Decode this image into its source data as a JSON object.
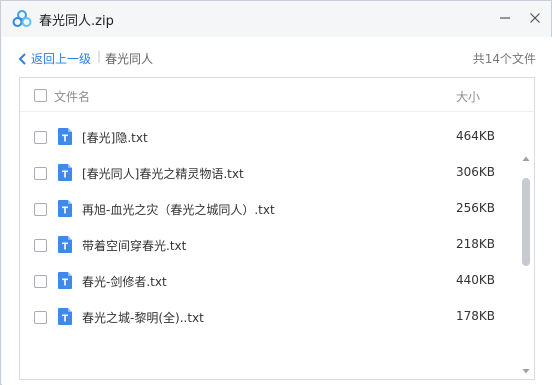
{
  "window": {
    "title": "春光同人.zip",
    "icons": {
      "app": "baidu-netdisk-cloud-icon",
      "minimize": "minimize-icon",
      "close": "close-icon"
    }
  },
  "nav": {
    "back_label": "返回上一级",
    "separator": "|",
    "current_folder": "春光同人",
    "total_count": "共14个文件"
  },
  "list": {
    "header": {
      "name_label": "文件名",
      "size_label": "大小"
    },
    "files": [
      {
        "name": "[春光]隐.txt",
        "size": "464KB"
      },
      {
        "name": "[春光同人]春光之精灵物语.txt",
        "size": "306KB"
      },
      {
        "name": "再旭-血光之灾（春光之城同人）.txt",
        "size": "256KB"
      },
      {
        "name": "带着空间穿春光.txt",
        "size": "218KB"
      },
      {
        "name": "春光-剑修者.txt",
        "size": "440KB"
      },
      {
        "name": "春光之城-黎明(全)..txt",
        "size": "178KB"
      }
    ],
    "scroll_position": 0.1
  },
  "colors": {
    "accent": "#2f7fe0",
    "file_icon": "#3d8ae8",
    "scroll_thumb": "#c7cbd1"
  }
}
